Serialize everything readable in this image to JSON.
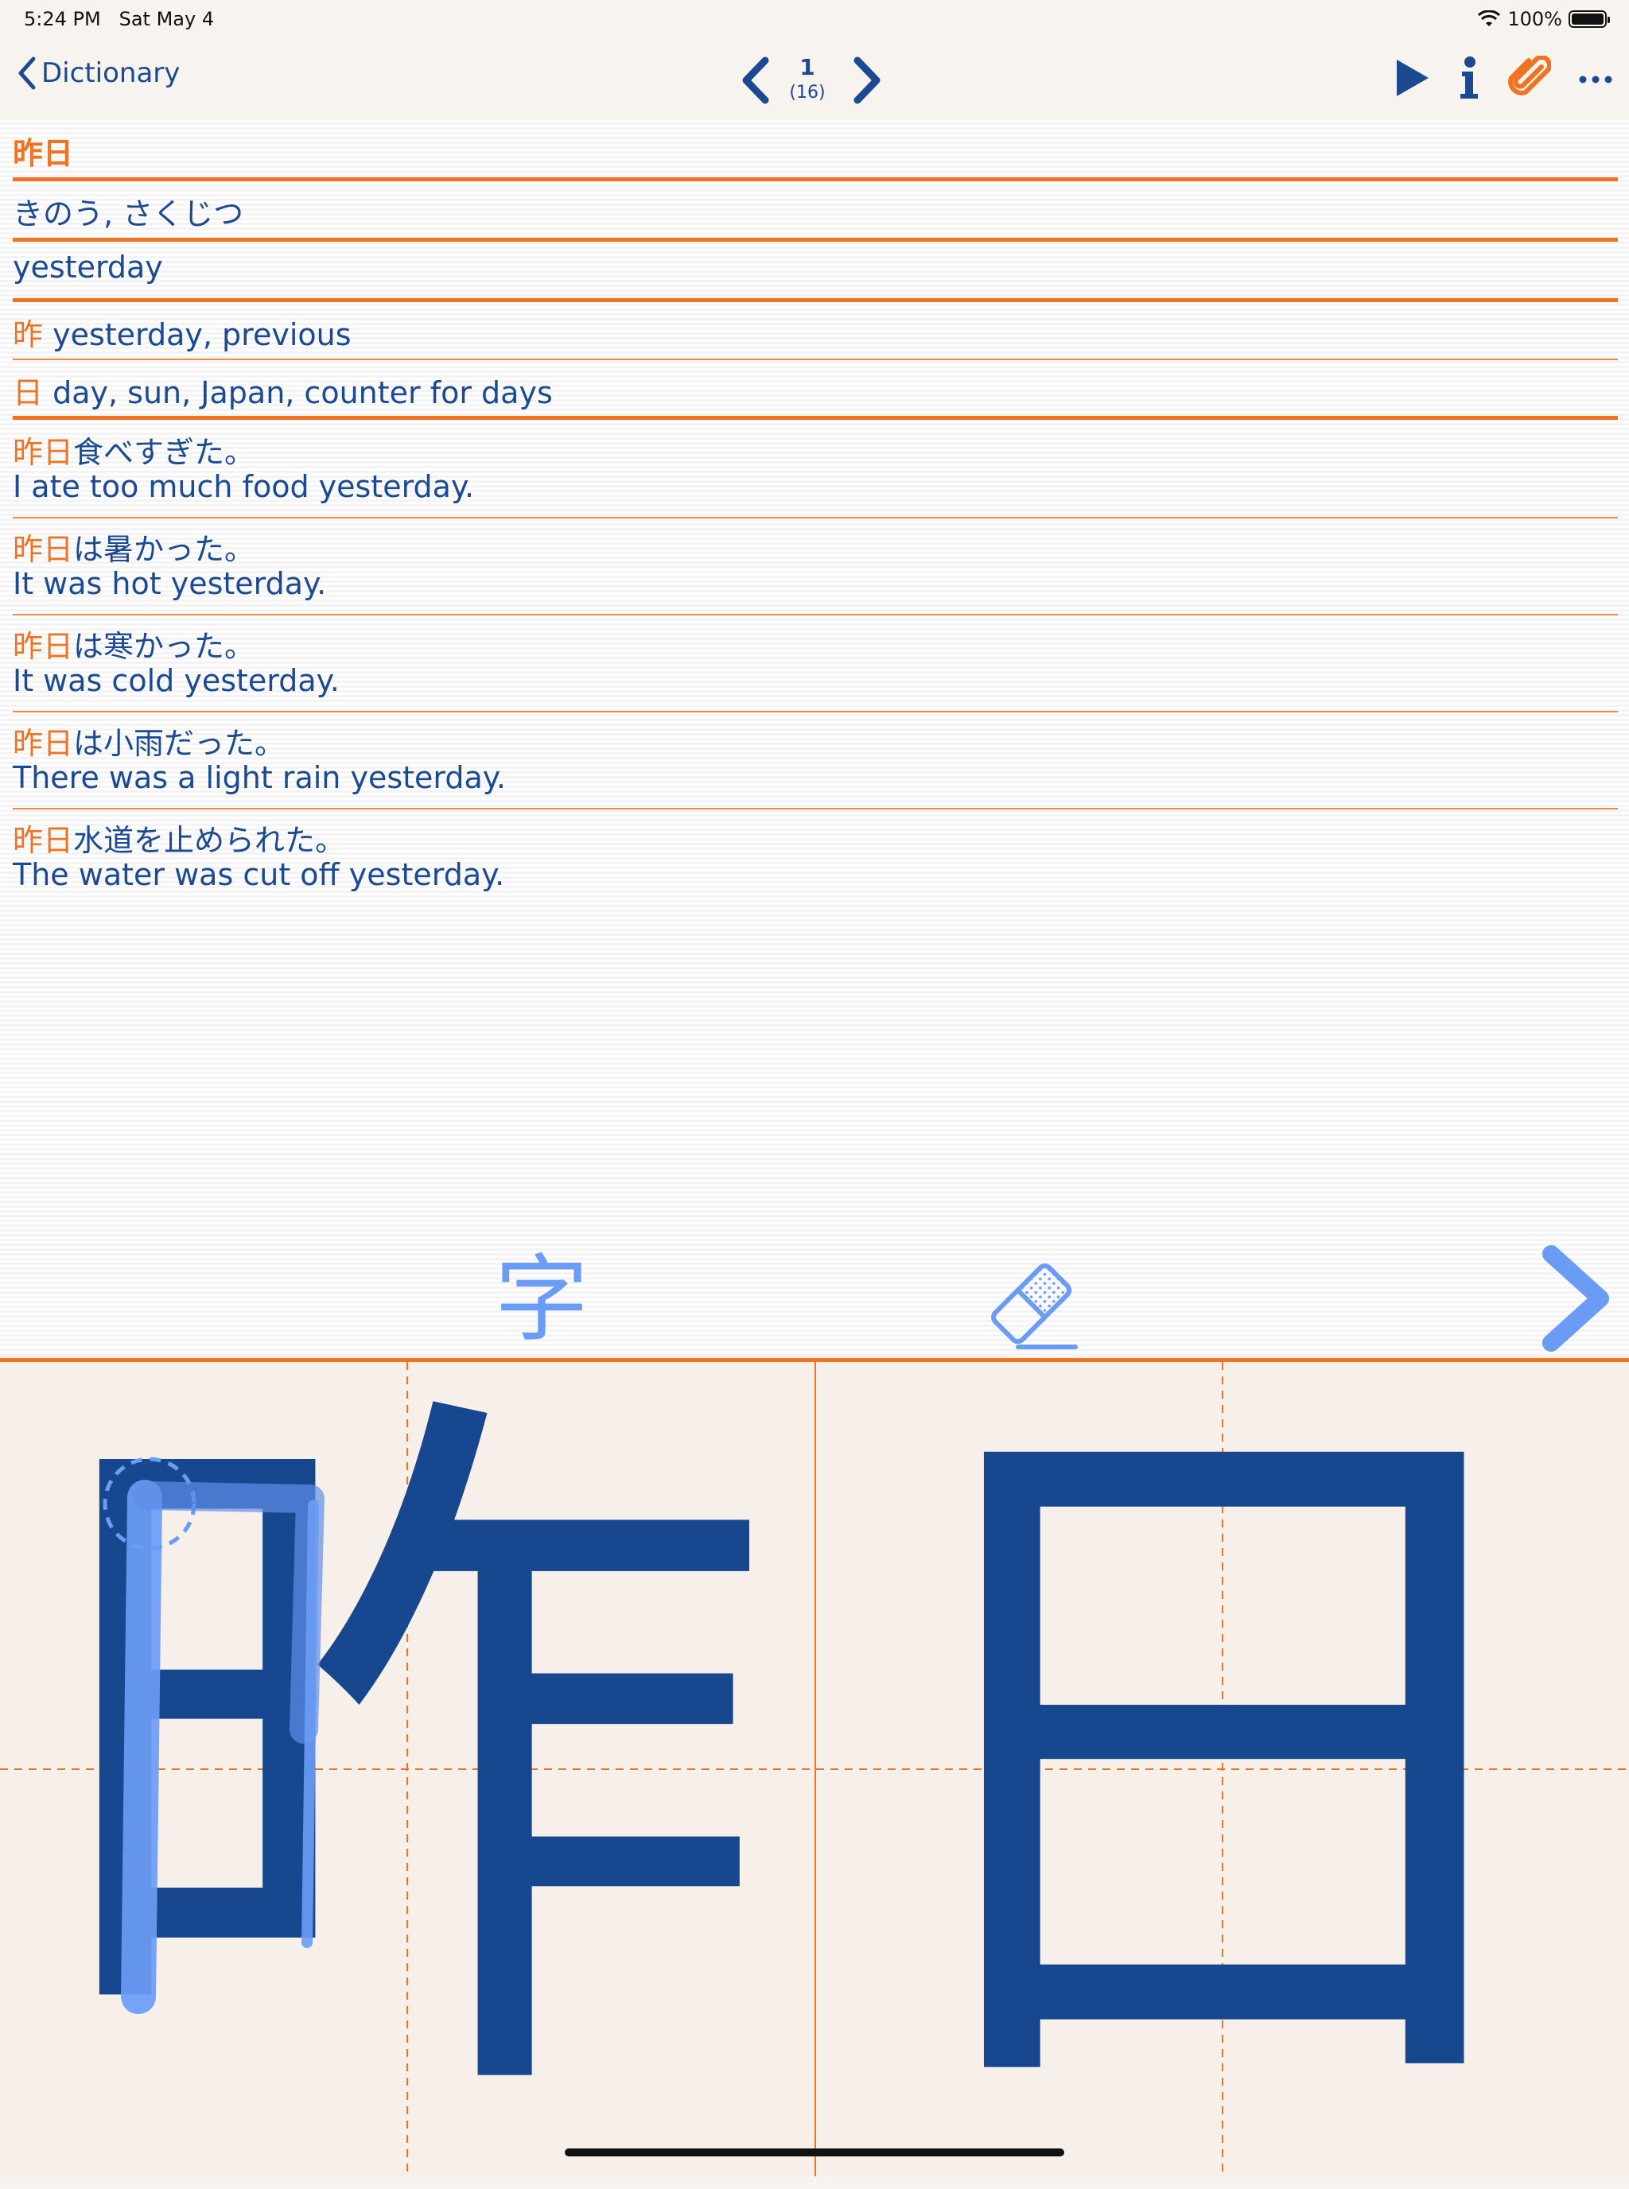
{
  "status_bar": {
    "time": "5:24 PM",
    "date": "Sat May 4",
    "battery": "100%",
    "battery_level": 1.0
  },
  "nav": {
    "back_label": "Dictionary",
    "page_current": "1",
    "page_total": "(16)"
  },
  "entry": {
    "word": "昨日",
    "reading": "きのう, さくじつ",
    "meaning": "yesterday",
    "kanji": [
      {
        "char": "昨",
        "meaning": "yesterday, previous"
      },
      {
        "char": "日",
        "meaning": "day, sun, Japan, counter for days"
      }
    ],
    "examples": [
      {
        "word": "昨日",
        "rest": "食べすぎた。",
        "en": "I ate too much food yesterday."
      },
      {
        "word": "昨日",
        "rest": "は暑かった。",
        "en": "It was hot yesterday."
      },
      {
        "word": "昨日",
        "rest": "は寒かった。",
        "en": "It was cold yesterday."
      },
      {
        "word": "昨日",
        "rest": "は小雨だった。",
        "en": "There was a light rain yesterday."
      },
      {
        "word": "昨日",
        "rest": "水道を止められた。",
        "en": "The water was cut off yesterday."
      }
    ]
  },
  "pad_tools": {
    "kanji_toggle": "字"
  },
  "writing_pad": {
    "characters": [
      "昨",
      "日"
    ]
  },
  "colors": {
    "accent": "#f07321",
    "text": "#1b4a93",
    "stroke": "#6a9cf5"
  },
  "icons": [
    "chevron-left-icon",
    "chevron-right-icon",
    "play-icon",
    "info-icon",
    "paperclip-icon",
    "more-icon",
    "eraser-icon"
  ]
}
